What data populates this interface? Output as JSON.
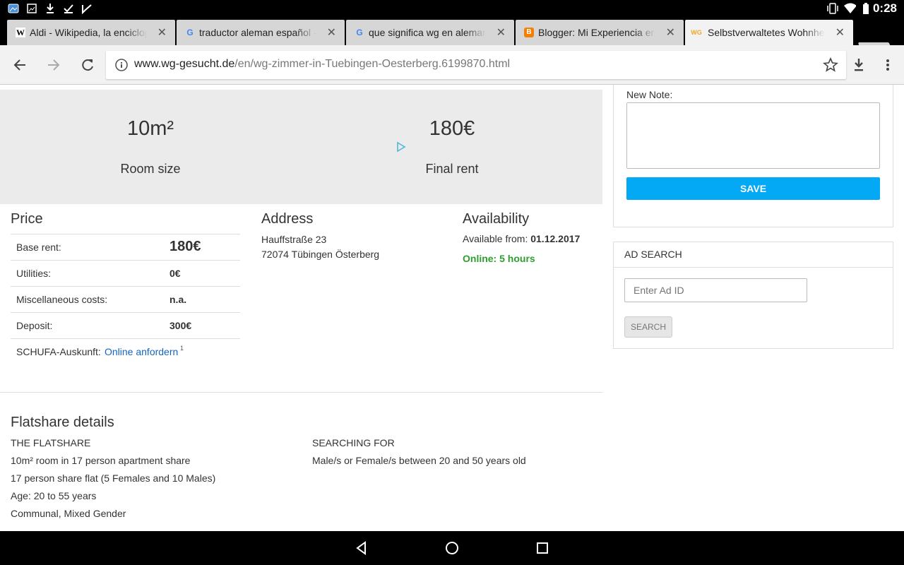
{
  "statusbar": {
    "time": "0:28",
    "left_icons": [
      "image-icon",
      "photo-icon",
      "download-icon",
      "check-icon",
      "check-icon"
    ],
    "right_icons": [
      "vibrate-icon",
      "wifi-icon",
      "battery-icon"
    ]
  },
  "tabs": [
    {
      "title": "Aldi - Wikipedia, la enciclopedia libre",
      "favicon": "W",
      "favicon_color": "#000000",
      "active": false
    },
    {
      "title": "traductor aleman español - Buscar con Google",
      "favicon": "G",
      "favicon_color": "#4285f4",
      "active": false
    },
    {
      "title": "que significa wg en aleman - Buscar con Google",
      "favicon": "G",
      "favicon_color": "#4285f4",
      "active": false
    },
    {
      "title": "Blogger: Mi Experiencia en Alemania",
      "favicon": "B",
      "favicon_color": "#f57d00",
      "active": false
    },
    {
      "title": "Selbstverwaltetes Wohnheim",
      "favicon": "WG",
      "favicon_color": "#f5a623",
      "active": true
    }
  ],
  "toolbar": {
    "url_host": "www.wg-gesucht.de",
    "url_path": "/en/wg-zimmer-in-Tuebingen-Oesterberg.6199870.html"
  },
  "keyfacts": {
    "room_size_value": "10m²",
    "room_size_label": "Room size",
    "rent_value": "180€",
    "rent_label": "Final rent"
  },
  "price": {
    "title": "Price",
    "rows": [
      {
        "label": "Base rent:",
        "value": "180€"
      },
      {
        "label": "Utilities:",
        "value": "0€"
      },
      {
        "label": "Miscellaneous costs:",
        "value": "n.a."
      },
      {
        "label": "Deposit:",
        "value": "300€"
      }
    ],
    "schufa_label": "SCHUFA-Auskunft:",
    "schufa_link": "Online anfordern",
    "schufa_sup": "1"
  },
  "address": {
    "title": "Address",
    "line1": "Hauffstraße 23",
    "line2": "72074 Tübingen Österberg"
  },
  "availability": {
    "title": "Availability",
    "from_label": "Available from:",
    "from_value": "01.12.2017",
    "online": "Online: 5 hours",
    "online_color": "#2e9e2e"
  },
  "flatshare": {
    "title": "Flatshare details",
    "the_flatshare_heading": "THE FLATSHARE",
    "details": [
      "10m² room in 17 person apartment share",
      "17 person share flat (5 Females and 10 Males)",
      "Age: 20 to 55 years",
      "Communal, Mixed Gender"
    ],
    "searching_heading": "SEARCHING FOR",
    "searching_text": "Male/s or Female/s between 20 and 50 years old"
  },
  "sidebar": {
    "note_label": "New Note:",
    "save_label": "SAVE",
    "ad_search_title": "AD SEARCH",
    "ad_id_placeholder": "Enter Ad ID",
    "search_button": "SEARCH",
    "accent_color": "#03a9f4"
  }
}
